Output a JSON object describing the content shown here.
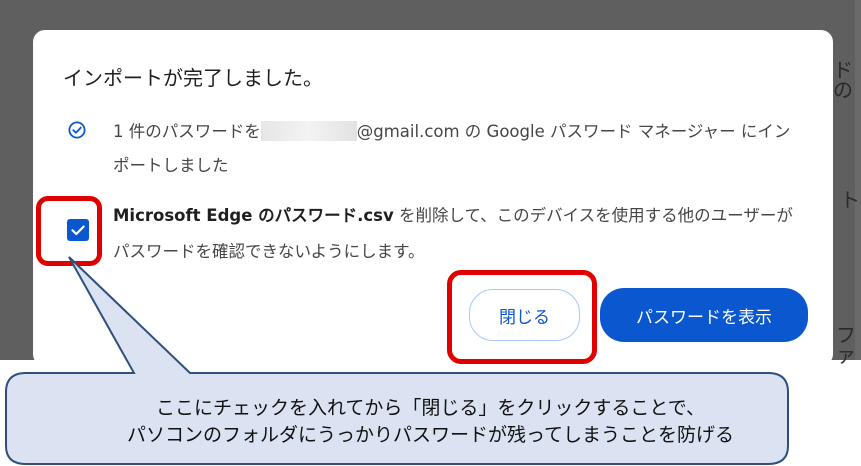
{
  "background": {
    "top_right_fragment": "ドの",
    "mid_right_fragment": "ト",
    "bottom_right_fragment": "ファ"
  },
  "dialog": {
    "title": "インポートが完了しました。",
    "message1_prefix": "1 件のパスワードを",
    "message1_suffix": "@gmail.com の Google パスワード マネージャー にインポートしました",
    "checkbox_checked": true,
    "message2_bold": "Microsoft Edge のパスワード.csv",
    "message2_rest": " を削除して、このデバイスを使用する他のユーザーがパスワードを確認できないようにします。",
    "close_button": "閉じる",
    "show_button": "パスワードを表示"
  },
  "callout": {
    "line1": "ここにチェックを入れてから「閉じる」をクリックすることで、",
    "line2": "パソコンのフォルダにうっかりパスワードが残ってしまうことを防げる"
  },
  "colors": {
    "accent": "#0b57d0",
    "highlight_frame": "#e00000",
    "callout_fill": "#dbe3f3",
    "callout_border": "#2f4f7f"
  }
}
